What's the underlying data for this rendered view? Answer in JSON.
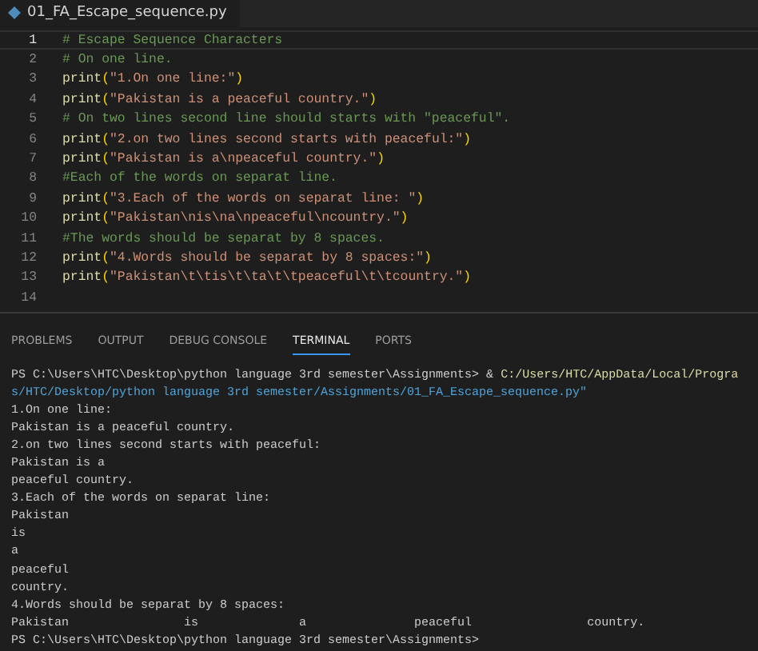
{
  "file_tab": {
    "title": "01_FA_Escape_sequence.py"
  },
  "editor": {
    "lines": [
      {
        "number": "1",
        "current": true,
        "tokens": [
          {
            "kind": "comment",
            "text": "# Escape Sequence Characters"
          }
        ]
      },
      {
        "number": "2",
        "current": false,
        "tokens": [
          {
            "kind": "comment",
            "text": "# On one line."
          }
        ]
      },
      {
        "number": "3",
        "current": false,
        "tokens": [
          {
            "kind": "function",
            "text": "print"
          },
          {
            "kind": "paren",
            "text": "("
          },
          {
            "kind": "string",
            "text": "\"1.On one line:\""
          },
          {
            "kind": "paren",
            "text": ")"
          }
        ]
      },
      {
        "number": "4",
        "current": false,
        "tokens": [
          {
            "kind": "function",
            "text": "print"
          },
          {
            "kind": "paren",
            "text": "("
          },
          {
            "kind": "string",
            "text": "\"Pakistan is a peaceful country.\""
          },
          {
            "kind": "paren",
            "text": ")"
          }
        ]
      },
      {
        "number": "5",
        "current": false,
        "tokens": [
          {
            "kind": "comment",
            "text": "# On two lines second line should starts with \"peaceful\"."
          }
        ]
      },
      {
        "number": "6",
        "current": false,
        "tokens": [
          {
            "kind": "function",
            "text": "print"
          },
          {
            "kind": "paren",
            "text": "("
          },
          {
            "kind": "string",
            "text": "\"2.on two lines second starts with peaceful:\""
          },
          {
            "kind": "paren",
            "text": ")"
          }
        ]
      },
      {
        "number": "7",
        "current": false,
        "tokens": [
          {
            "kind": "function",
            "text": "print"
          },
          {
            "kind": "paren",
            "text": "("
          },
          {
            "kind": "string",
            "text": "\"Pakistan is a\\npeaceful country.\""
          },
          {
            "kind": "paren",
            "text": ")"
          }
        ]
      },
      {
        "number": "8",
        "current": false,
        "tokens": [
          {
            "kind": "comment",
            "text": "#Each of the words on separat line."
          }
        ]
      },
      {
        "number": "9",
        "current": false,
        "tokens": [
          {
            "kind": "function",
            "text": "print"
          },
          {
            "kind": "paren",
            "text": "("
          },
          {
            "kind": "string",
            "text": "\"3.Each of the words on separat line: \""
          },
          {
            "kind": "paren",
            "text": ")"
          }
        ]
      },
      {
        "number": "10",
        "current": false,
        "tokens": [
          {
            "kind": "function",
            "text": "print"
          },
          {
            "kind": "paren",
            "text": "("
          },
          {
            "kind": "string",
            "text": "\"Pakistan\\nis\\na\\npeaceful\\ncountry.\""
          },
          {
            "kind": "paren",
            "text": ")"
          }
        ]
      },
      {
        "number": "11",
        "current": false,
        "tokens": [
          {
            "kind": "comment",
            "text": "#The words should be separat by 8 spaces."
          }
        ]
      },
      {
        "number": "12",
        "current": false,
        "tokens": [
          {
            "kind": "function",
            "text": "print"
          },
          {
            "kind": "paren",
            "text": "("
          },
          {
            "kind": "string",
            "text": "\"4.Words should be separat by 8 spaces:\""
          },
          {
            "kind": "paren",
            "text": ")"
          }
        ]
      },
      {
        "number": "13",
        "current": false,
        "tokens": [
          {
            "kind": "function",
            "text": "print"
          },
          {
            "kind": "paren",
            "text": "("
          },
          {
            "kind": "string",
            "text": "\"Pakistan\\t\\tis\\t\\ta\\t\\tpeaceful\\t\\tcountry.\""
          },
          {
            "kind": "paren",
            "text": ")"
          }
        ]
      },
      {
        "number": "14",
        "current": false
      }
    ]
  },
  "panel_tabs": [
    {
      "label": "PROBLEMS",
      "selected": false
    },
    {
      "label": "OUTPUT",
      "selected": false
    },
    {
      "label": "DEBUG CONSOLE",
      "selected": false
    },
    {
      "label": "TERMINAL",
      "selected": true
    },
    {
      "label": "PORTS",
      "selected": false
    }
  ],
  "terminal": {
    "lines": [
      [
        {
          "kind": "plain",
          "text": "PS C:\\Users\\HTC\\Desktop\\python language 3rd semester\\Assignments> & "
        },
        {
          "kind": "command",
          "text": "C:/Users/HTC/AppData/Local/Progra"
        }
      ],
      [
        {
          "kind": "path",
          "text": "s/HTC/Desktop/python language 3rd semester/Assignments/01_FA_Escape_sequence.py\""
        }
      ],
      [
        {
          "kind": "plain",
          "text": "1.On one line:"
        }
      ],
      [
        {
          "kind": "plain",
          "text": "Pakistan is a peaceful country."
        }
      ],
      [
        {
          "kind": "plain",
          "text": "2.on two lines second starts with peaceful:"
        }
      ],
      [
        {
          "kind": "plain",
          "text": "Pakistan is a"
        }
      ],
      [
        {
          "kind": "plain",
          "text": "peaceful country."
        }
      ],
      [
        {
          "kind": "plain",
          "text": "3.Each of the words on separat line:"
        }
      ],
      [
        {
          "kind": "plain",
          "text": "Pakistan"
        }
      ],
      [
        {
          "kind": "plain",
          "text": "is"
        }
      ],
      [
        {
          "kind": "plain",
          "text": "a"
        }
      ],
      [
        {
          "kind": "plain",
          "text": "peaceful"
        }
      ],
      [
        {
          "kind": "plain",
          "text": "country."
        }
      ],
      [
        {
          "kind": "plain",
          "text": "4.Words should be separat by 8 spaces:"
        }
      ],
      [
        {
          "kind": "plain",
          "text": "Pakistan\t\tis\t\ta\t\tpeaceful\t\tcountry."
        }
      ],
      [
        {
          "kind": "plain",
          "text": "PS C:\\Users\\HTC\\Desktop\\python language 3rd semester\\Assignments>"
        }
      ]
    ]
  }
}
